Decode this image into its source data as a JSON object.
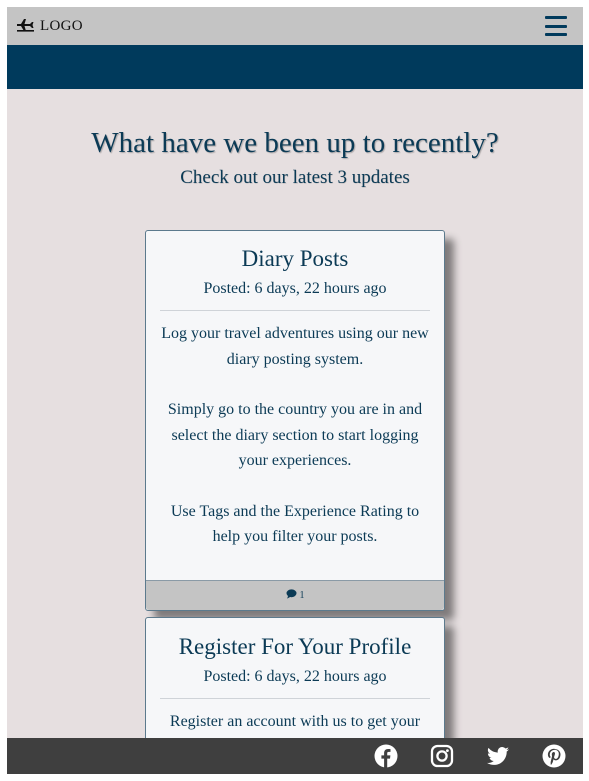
{
  "header": {
    "logo_text": "LOGO",
    "logo_icon": "plane-icon",
    "menu_icon": "hamburger-menu-icon"
  },
  "intro": {
    "title": "What have we been up to recently?",
    "subtitle": "Check out our latest 3 updates"
  },
  "posts": [
    {
      "title": "Diary Posts",
      "posted": "Posted: 6 days, 22 hours ago",
      "paragraphs": [
        "Log your travel adventures using our new diary posting system.",
        "Simply go to the country you are in and select the diary section to start logging your experiences.",
        "Use Tags and the Experience Rating to help you filter your posts."
      ],
      "comment_count": "1",
      "comment_icon": "comment-icon"
    },
    {
      "title": "Register For Your Profile",
      "posted": "Posted: 6 days, 22 hours ago",
      "paragraphs": [
        "Register an account with us to get your"
      ]
    }
  ],
  "footer": {
    "social_icons": [
      "facebook-icon",
      "instagram-icon",
      "twitter-icon",
      "pinterest-icon"
    ]
  },
  "colors": {
    "navy": "#003a5c",
    "page_bg": "#e6dfe0",
    "bar_grey": "#c4c4c4",
    "footer_bg": "#3f3f3f"
  }
}
